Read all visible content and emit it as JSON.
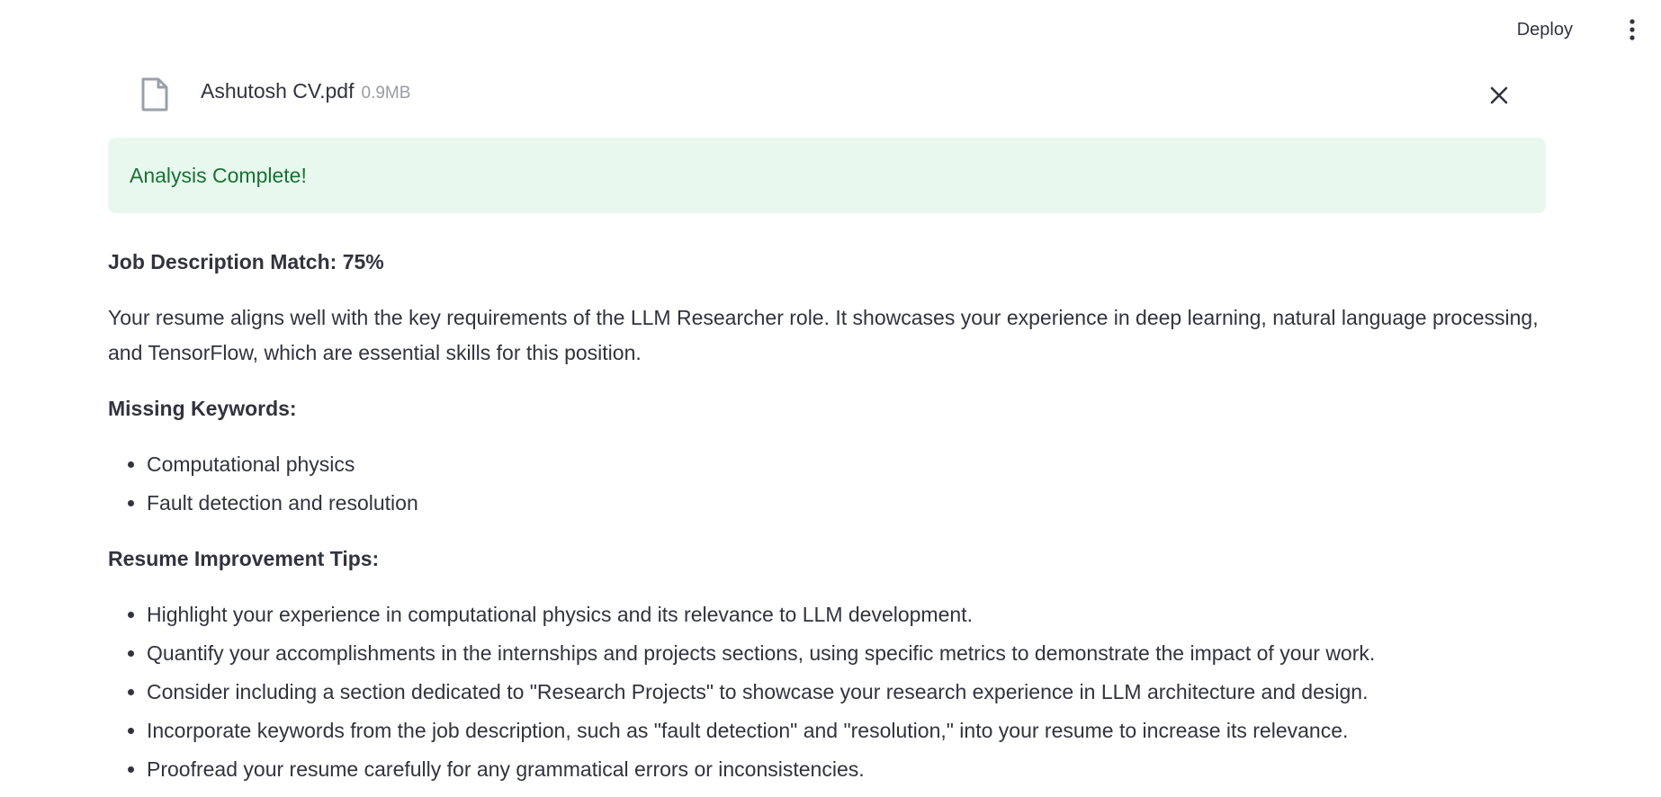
{
  "header": {
    "deploy_label": "Deploy",
    "menu_icon": "vertical-dots-icon"
  },
  "file": {
    "icon": "file-icon",
    "name": "Ashutosh CV.pdf",
    "size": "0.9MB",
    "remove_icon": "close-icon"
  },
  "alert": {
    "message": "Analysis Complete!",
    "background": "#e8f8ee",
    "text_color": "#177233"
  },
  "results": {
    "match_heading": "Job Description Match: 75%",
    "summary": "Your resume aligns well with the key requirements of the LLM Researcher role. It showcases your experience in deep learning, natural language processing, and TensorFlow, which are essential skills for this position.",
    "missing_heading": "Missing Keywords:",
    "missing_keywords": [
      "Computational physics",
      "Fault detection and resolution"
    ],
    "tips_heading": "Resume Improvement Tips:",
    "tips": [
      "Highlight your experience in computational physics and its relevance to LLM development.",
      "Quantify your accomplishments in the internships and projects sections, using specific metrics to demonstrate the impact of your work.",
      "Consider including a section dedicated to \"Research Projects\" to showcase your research experience in LLM architecture and design.",
      "Incorporate keywords from the job description, such as \"fault detection\" and \"resolution,\" into your resume to increase its relevance.",
      "Proofread your resume carefully for any grammatical errors or inconsistencies."
    ]
  }
}
